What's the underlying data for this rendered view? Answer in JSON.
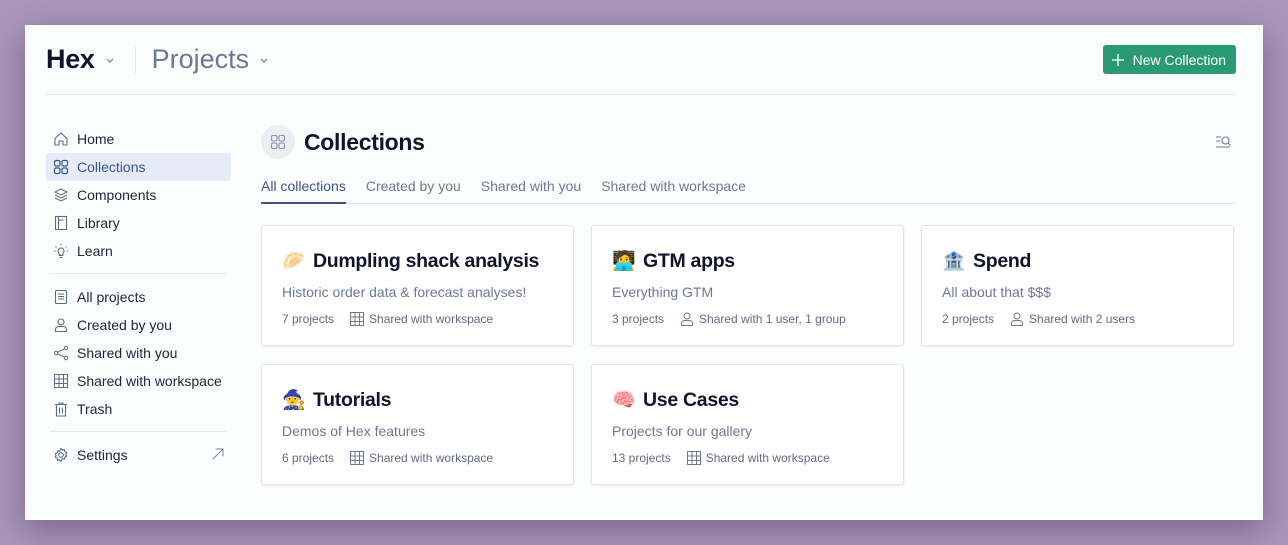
{
  "topbar": {
    "workspace": "Hex",
    "section": "Projects",
    "new_collection_label": "New Collection",
    "accent_color": "#2a9a74"
  },
  "sidebar": {
    "items": [
      {
        "label": "Home",
        "icon": "home-icon"
      },
      {
        "label": "Collections",
        "icon": "collections-icon",
        "active": true
      },
      {
        "label": "Components",
        "icon": "layers-icon"
      },
      {
        "label": "Library",
        "icon": "book-icon"
      },
      {
        "label": "Learn",
        "icon": "lightbulb-icon"
      }
    ],
    "project_items": [
      {
        "label": "All projects",
        "icon": "document-icon"
      },
      {
        "label": "Created by you",
        "icon": "user-icon"
      },
      {
        "label": "Shared with you",
        "icon": "share-icon"
      },
      {
        "label": "Shared with workspace",
        "icon": "building-icon"
      },
      {
        "label": "Trash",
        "icon": "trash-icon"
      }
    ],
    "settings_label": "Settings"
  },
  "main": {
    "title": "Collections",
    "tabs": [
      {
        "label": "All collections",
        "active": true
      },
      {
        "label": "Created by you"
      },
      {
        "label": "Shared with you"
      },
      {
        "label": "Shared with workspace"
      }
    ],
    "collections": [
      {
        "emoji": "🥟",
        "name": "Dumpling shack analysis",
        "description": "Historic order data & forecast analyses!",
        "count": "7 projects",
        "share_icon": "building-icon",
        "shared": "Shared with workspace"
      },
      {
        "emoji": "🧑‍💻",
        "name": "GTM apps",
        "description": "Everything GTM",
        "count": "3 projects",
        "share_icon": "user-icon",
        "shared": "Shared with 1 user, 1 group"
      },
      {
        "emoji": "🏦",
        "name": "Spend",
        "description": "All about that $$$",
        "count": "2 projects",
        "share_icon": "user-icon",
        "shared": "Shared with 2 users"
      },
      {
        "emoji": "🧙",
        "name": "Tutorials",
        "description": "Demos of Hex features",
        "count": "6 projects",
        "share_icon": "building-icon",
        "shared": "Shared with workspace"
      },
      {
        "emoji": "🧠",
        "name": "Use Cases",
        "description": "Projects for our gallery",
        "count": "13 projects",
        "share_icon": "building-icon",
        "shared": "Shared with workspace"
      }
    ]
  }
}
